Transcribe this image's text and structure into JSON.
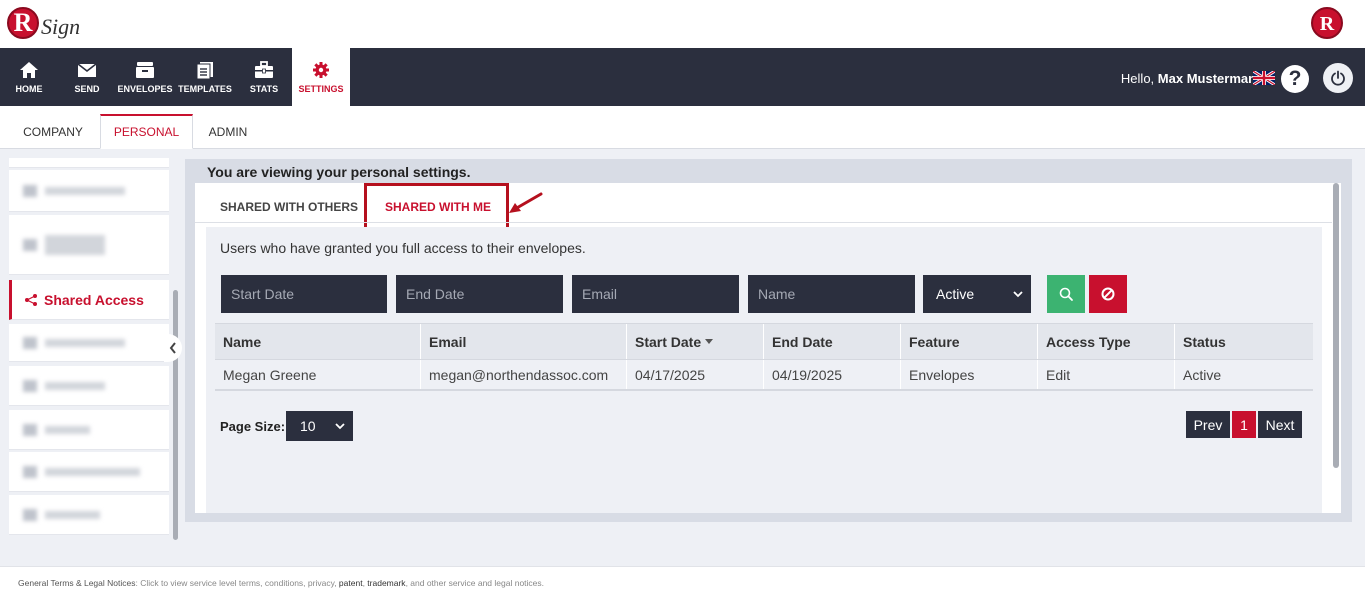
{
  "brand": {
    "logo_letter": "R",
    "logo_text": "Sign"
  },
  "nav": {
    "items": [
      {
        "label": "HOME",
        "icon": "home-icon"
      },
      {
        "label": "SEND",
        "icon": "envelope-icon"
      },
      {
        "label": "ENVELOPES",
        "icon": "inbox-icon"
      },
      {
        "label": "TEMPLATES",
        "icon": "templates-icon"
      },
      {
        "label": "STATS",
        "icon": "briefcase-icon"
      },
      {
        "label": "SETTINGS",
        "icon": "gear-icon",
        "active": true
      }
    ],
    "greeting_prefix": "Hello,",
    "user_name": "Max Mustermann",
    "help_glyph": "?"
  },
  "settings_tabs": [
    "COMPANY",
    "PERSONAL",
    "ADMIN"
  ],
  "sidebar": {
    "active_item": "Shared Access"
  },
  "content": {
    "viewing_text": "You are viewing your personal settings.",
    "sub_tabs": [
      "SHARED WITH OTHERS",
      "SHARED WITH ME"
    ],
    "description": "Users who have granted you full access to their envelopes.",
    "filters": {
      "start_date_placeholder": "Start Date",
      "end_date_placeholder": "End Date",
      "email_placeholder": "Email",
      "name_placeholder": "Name",
      "status_value": "Active"
    },
    "table": {
      "columns": [
        "Name",
        "Email",
        "Start Date",
        "End Date",
        "Feature",
        "Access Type",
        "Status"
      ],
      "rows": [
        [
          "Megan Greene",
          "megan@northendassoc.com",
          "04/17/2025",
          "04/19/2025",
          "Envelopes",
          "Edit",
          "Active"
        ]
      ]
    },
    "page_size_label": "Page Size:",
    "page_size_value": "10",
    "pager": {
      "prev": "Prev",
      "current": "1",
      "next": "Next"
    }
  },
  "footer": {
    "lead": "General Terms & Legal Notices",
    "text1": ": Click to view service level terms, conditions, privacy, ",
    "patent": "patent",
    "sep": ", ",
    "trademark": "trademark",
    "text2": ", and other service and legal notices."
  },
  "colors": {
    "brand_red": "#c8102e",
    "nav_dark": "#2b2f3e",
    "search_green": "#3cb371"
  }
}
